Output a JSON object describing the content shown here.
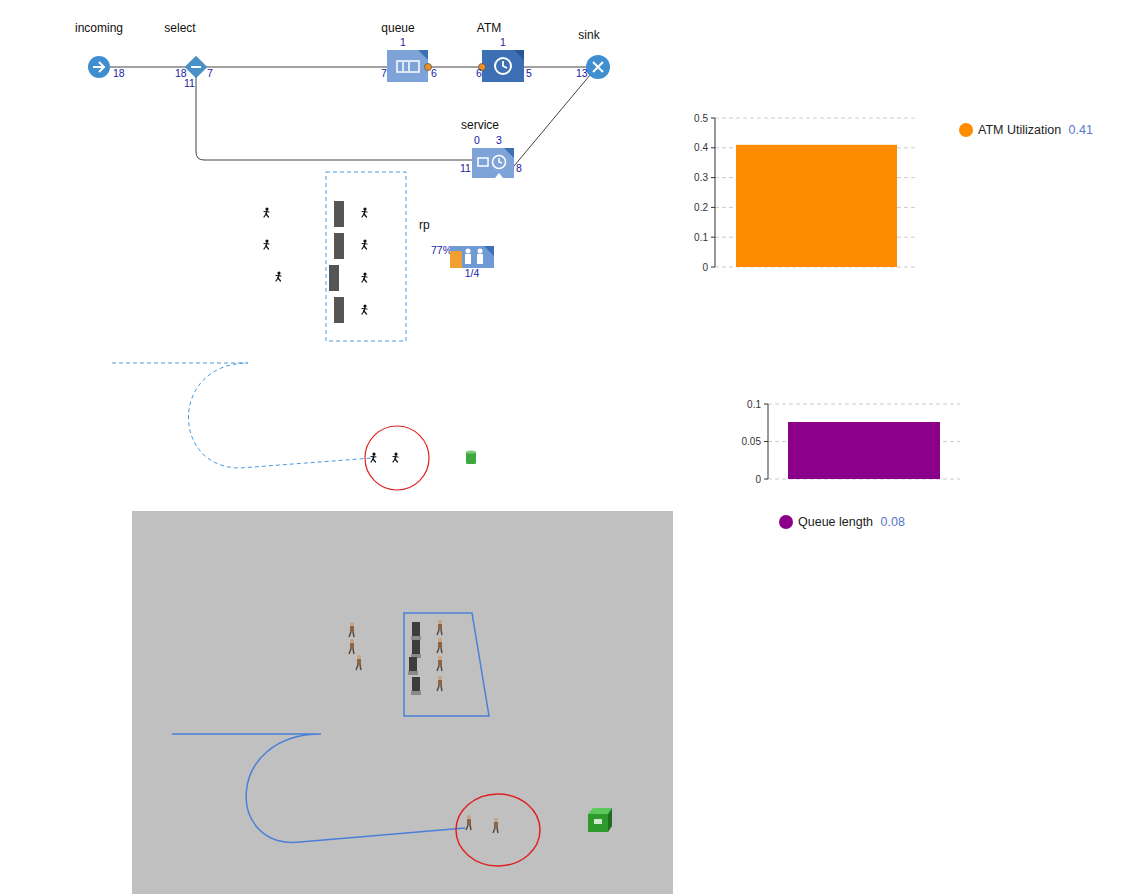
{
  "flowchart": {
    "source": {
      "name": "incoming",
      "out": "18"
    },
    "select": {
      "name": "select",
      "in": "18",
      "out_true": "7",
      "out_false": "11"
    },
    "queue": {
      "name": "queue",
      "size": "1",
      "in": "7",
      "out": "6"
    },
    "atm": {
      "name": "ATM",
      "busy": "1",
      "in": "6",
      "out": "5"
    },
    "sink": {
      "name": "sink",
      "in": "13"
    },
    "service": {
      "name": "service",
      "queue": "0",
      "busy": "3",
      "in": "11",
      "out": "8"
    },
    "resource_pool": {
      "name": "rp",
      "utilization": "77%",
      "level": 0.77,
      "busy": "1/4"
    }
  },
  "animation_2d": {
    "waiting_people": 3,
    "counters": 4,
    "people_at_counters": 4,
    "people_at_atm": 2
  },
  "animation_3d": {
    "waiting_people": 3,
    "counters": 4,
    "people_at_counters": 4,
    "people_at_atm": 2
  },
  "charts": [
    {
      "name": "utilization",
      "ticks": [
        "0.5",
        "0.4",
        "0.3",
        "0.2",
        "0.1",
        "0"
      ],
      "max": 0.5,
      "series": [
        {
          "label": "ATM Utilization",
          "reading": "0.41",
          "values": [
            0.41
          ],
          "color": "#ff8c00"
        }
      ]
    },
    {
      "name": "queue",
      "ticks": [
        "0.1",
        "0.05",
        "0"
      ],
      "max": 0.1,
      "series": [
        {
          "label": "Queue length",
          "reading": "0.08",
          "values": [
            0.076
          ],
          "color": "#8b008b"
        }
      ]
    }
  ]
}
